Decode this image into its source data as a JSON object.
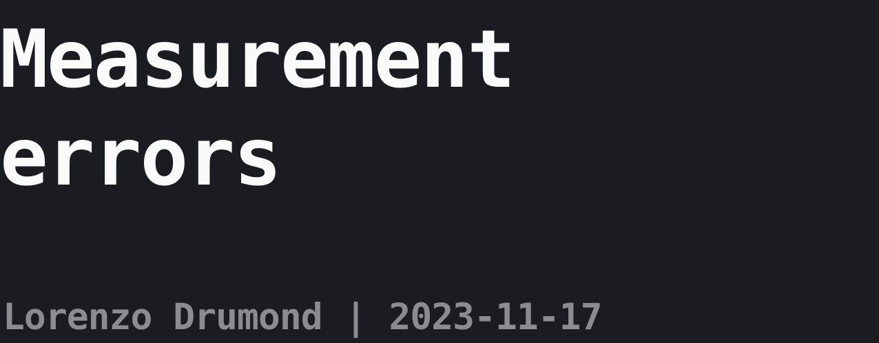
{
  "title": {
    "line1": "Measurement",
    "line2": "errors"
  },
  "byline": {
    "author": "Lorenzo Drumond",
    "separator": "|",
    "date": "2023-11-17"
  },
  "colors": {
    "background": "#1b1c21",
    "title": "#fafafa",
    "byline": "#8b8c90"
  }
}
